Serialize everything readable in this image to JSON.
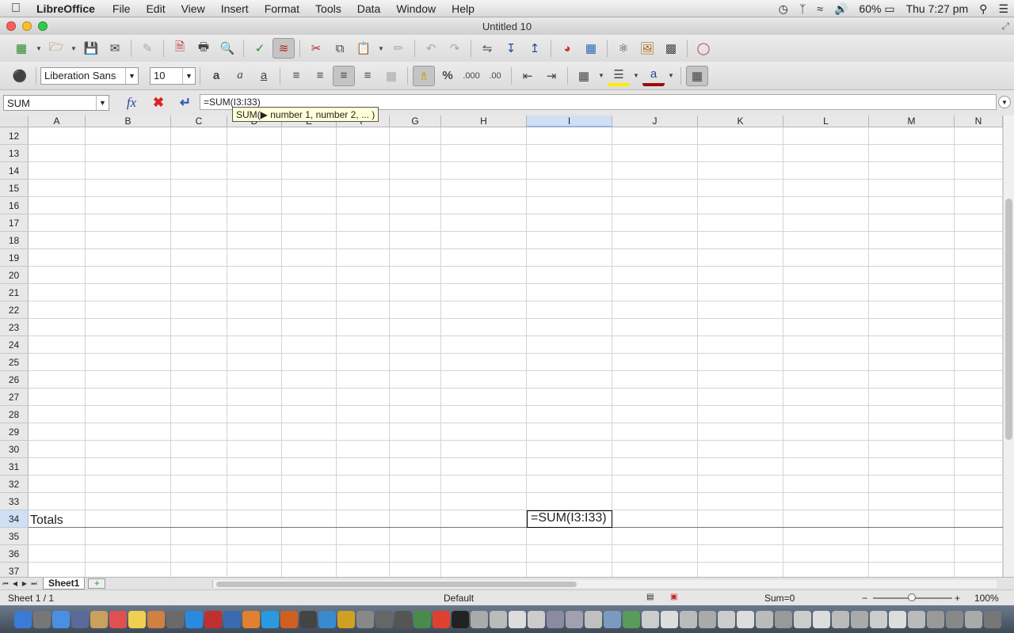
{
  "menubar": {
    "app_name": "LibreOffice",
    "menus": [
      "File",
      "Edit",
      "View",
      "Insert",
      "Format",
      "Tools",
      "Data",
      "Window",
      "Help"
    ],
    "status": {
      "battery": "60%",
      "clock": "Thu 7:27 pm"
    }
  },
  "window": {
    "title": "Untitled 10"
  },
  "toolbar2": {
    "font_name": "Liberation Sans",
    "font_size": "10"
  },
  "formula_bar": {
    "name_box": "SUM",
    "formula": "=SUM(I3:I33)",
    "tooltip": "SUM(▶ number 1, number 2, ... )"
  },
  "grid": {
    "columns": [
      "A",
      "B",
      "C",
      "D",
      "E",
      "F",
      "G",
      "H",
      "I",
      "J",
      "K",
      "L",
      "M",
      "N"
    ],
    "active_column": "I",
    "rows": [
      "12",
      "13",
      "14",
      "15",
      "16",
      "17",
      "18",
      "19",
      "20",
      "21",
      "22",
      "23",
      "24",
      "25",
      "26",
      "27",
      "28",
      "29",
      "30",
      "31",
      "32",
      "33",
      "34",
      "35",
      "36",
      "37"
    ],
    "active_row": "34",
    "cells": {
      "A34": "Totals",
      "I34": "=SUM(I3:I33)"
    }
  },
  "sheet_tabs": {
    "tabs": [
      "Sheet1"
    ],
    "add_label": "+"
  },
  "status_bar": {
    "sheet_pos": "Sheet 1 / 1",
    "page_style": "Default",
    "sum": "Sum=0",
    "zoom": "100%",
    "zoom_minus": "−",
    "zoom_plus": "+"
  },
  "colors": {
    "active_header": "#cfe0f4",
    "tooltip_bg": "#ffffd8",
    "close_red": "#fc5f57",
    "minimize_yellow": "#fdbc2e",
    "zoom_green": "#34c84a"
  }
}
